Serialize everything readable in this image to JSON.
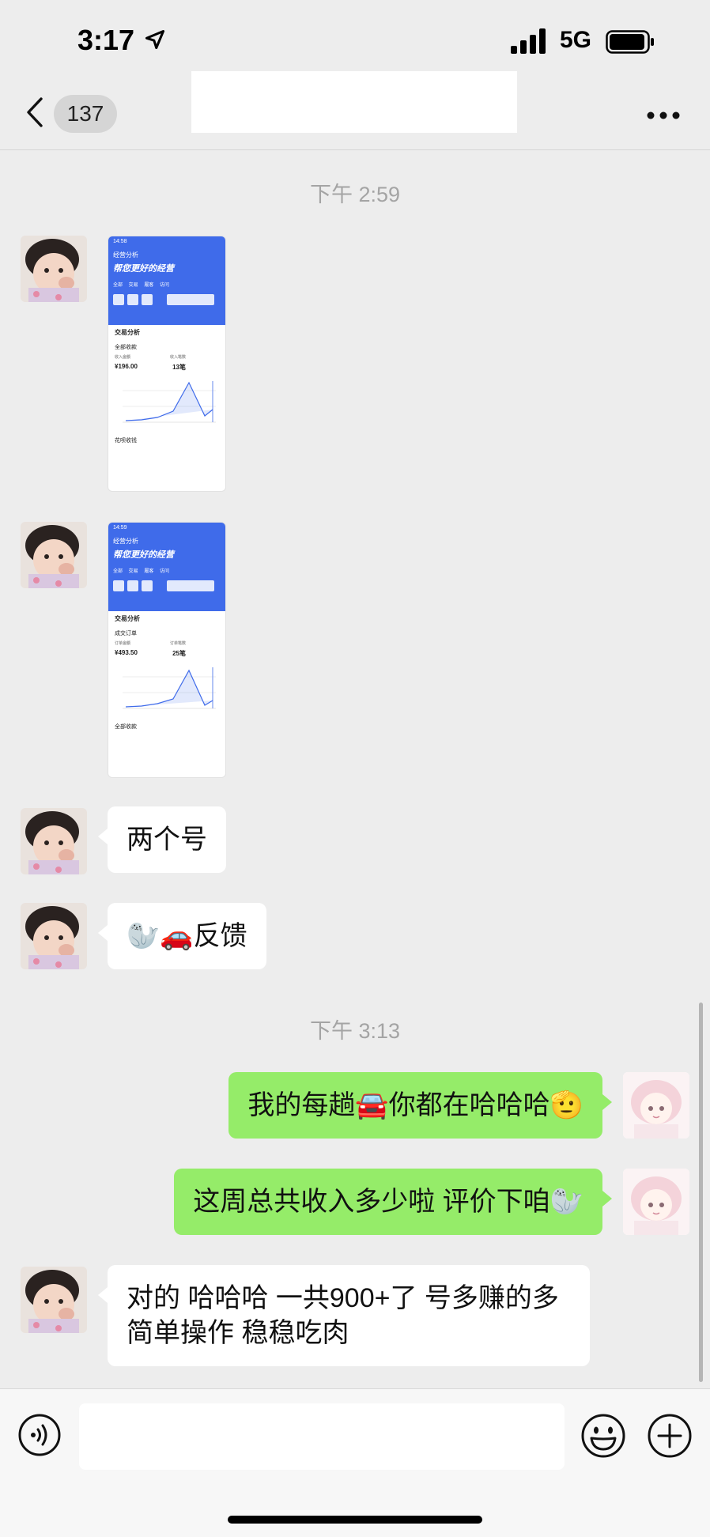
{
  "status_bar": {
    "time": "3:17",
    "network": "5G"
  },
  "nav": {
    "unread_count": "137"
  },
  "timestamps": [
    "下午 2:59",
    "下午 3:13"
  ],
  "screenshot_1": {
    "time": "14:58",
    "header": "经营分析",
    "slogan": "帮您更好的经营",
    "tabs": "全部 交易 履客 访问",
    "section": "交易分析",
    "card": "全部收款",
    "label_a": "收入金额",
    "label_b": "收入笔数",
    "value_a": "¥196.00",
    "value_b": "13笔",
    "footer": "花呗收钱"
  },
  "screenshot_2": {
    "time": "14:59",
    "header": "经营分析",
    "slogan": "帮您更好的经营",
    "tabs": "全部 交易 履客 访问",
    "section": "交易分析",
    "card": "成交订单",
    "label_a": "订单金额",
    "label_b": "订单笔数",
    "value_a": "¥493.50",
    "value_b": "25笔",
    "footer": "全部收款"
  },
  "messages": {
    "msg1": "两个号",
    "msg2": "🦭🚗反馈",
    "msg3": "我的每趟🚘你都在哈哈哈🫡",
    "msg4": "这周总共收入多少啦 评价下咱🦭",
    "msg5": "对的 哈哈哈 一共900+了 号多赚的多 简单操作  稳稳吃肉"
  },
  "input": {
    "placeholder": ""
  },
  "colors": {
    "outgoing_bubble": "#95ec69",
    "incoming_bubble": "#ffffff",
    "background": "#ededed",
    "screenshot_header": "#3f6bea"
  },
  "icons": [
    "back-chevron-icon",
    "more-icon",
    "voice-icon",
    "emoji-icon",
    "plus-icon",
    "location-arrow-icon",
    "signal-icon",
    "battery-icon"
  ]
}
